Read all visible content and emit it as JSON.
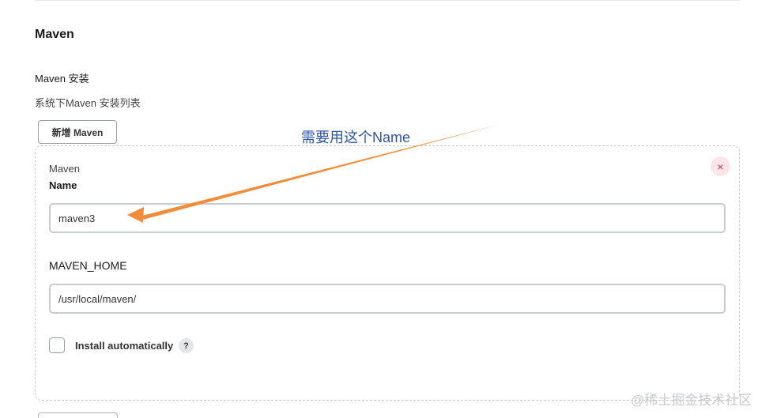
{
  "section": {
    "title": "Maven"
  },
  "installations": {
    "label": "Maven 安装",
    "description": "系统下Maven 安装列表",
    "add_button_label": "新增 Maven"
  },
  "card": {
    "heading": "Maven",
    "remove_icon": "×",
    "name_label": "Name",
    "name_value": "maven3",
    "home_label": "MAVEN_HOME",
    "home_value": "/usr/local/maven/",
    "install_auto_label": "Install automatically",
    "install_auto_checked": false,
    "help_icon": "?"
  },
  "annotation": {
    "text": "需要用这个Name",
    "arrow_color": "#f28c38",
    "text_color": "#2e57a8"
  },
  "watermark": {
    "text": "@稀土掘金技术社区"
  },
  "colors": {
    "remove_bg": "#fbe5e9",
    "remove_fg": "#c4314b",
    "border": "#c8cbcf"
  }
}
